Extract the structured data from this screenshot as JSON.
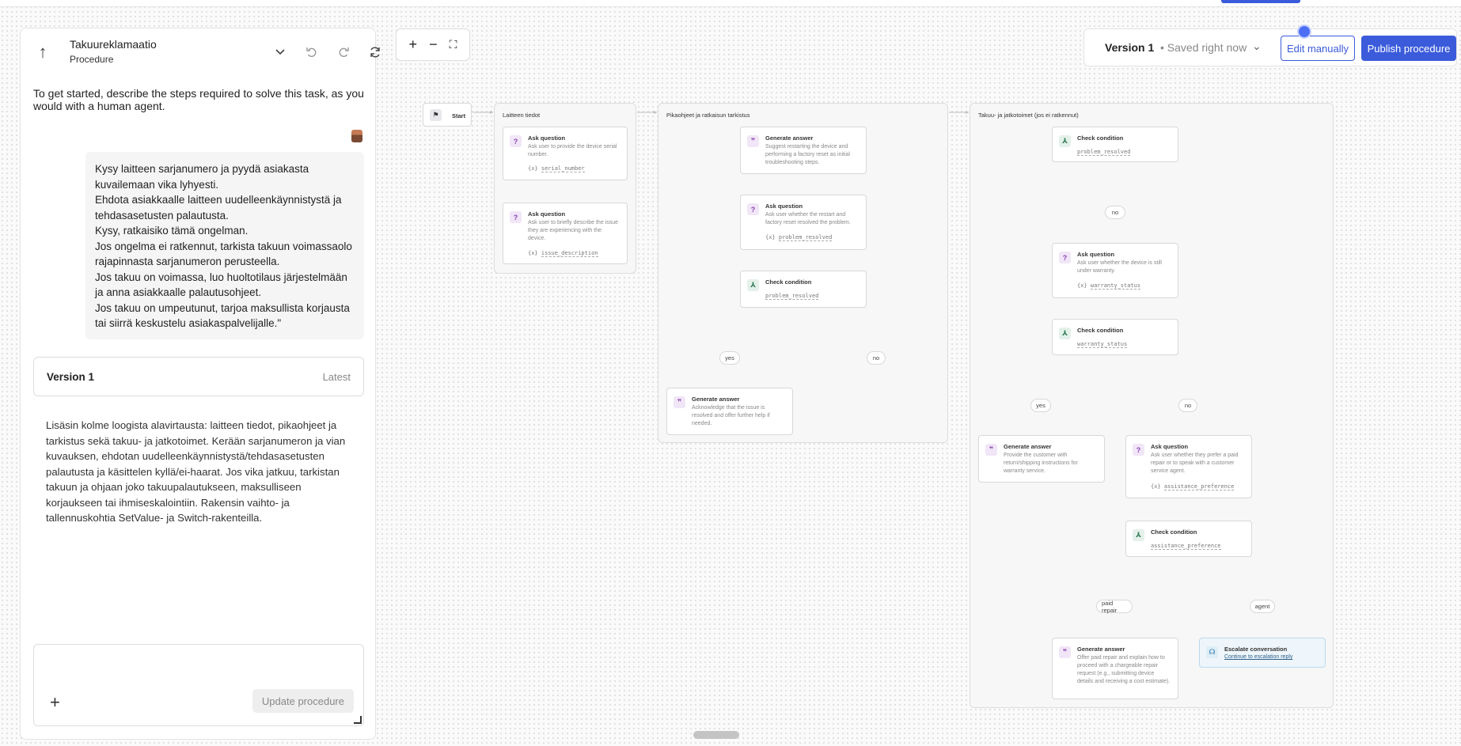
{
  "procedure": {
    "title": "Takuureklamaatio",
    "subtitle": "Procedure"
  },
  "chat": {
    "intro": "To get started, describe the steps required to solve this task, as you would with a human agent.",
    "user_lines": [
      "Kysy laitteen sarjanumero ja pyydä asiakasta kuvailemaan vika lyhyesti.",
      "Ehdota asiakkaalle laitteen uudelleenkäynnistystä ja tehdasasetusten palautusta.",
      "Kysy, ratkaisiko tämä ongelman.",
      "Jos ongelma ei ratkennut, tarkista takuun voimassaolo rajapinnasta sarjanumeron perusteella.",
      "Jos takuu on voimassa, luo huoltotilaus järjestelmään ja anna asiakkaalle palautusohjeet.",
      "Jos takuu on umpeutunut, tarjoa maksullista korjausta tai siirrä keskustelu asiakaspalvelijalle.\""
    ],
    "version_title": "Version 1",
    "version_label": "Latest",
    "assistant_reply": "Lisäsin kolme loogista alavirtausta: laitteen tiedot, pikaohjeet ja tarkistus sekä takuu- ja jatkotoimet. Kerään sarjanumeron ja vian kuvauksen, ehdotan uudelleenkäynnistystä/tehdasasetusten palautusta ja käsittelen kyllä/ei-haarat. Jos vika jatkuu, tarkistan takuun ja ohjaan joko takuupalautukseen, maksulliseen korjaukseen tai ihmiseskalointiin. Rakensin vaihto- ja tallennuskohtia SetValue- ja Switch-rakenteilla.",
    "composer_placeholder": "",
    "update_button": "Update procedure"
  },
  "zoom": {
    "in": "+",
    "out": "−",
    "fit": "⛶"
  },
  "versionbar": {
    "version": "Version 1",
    "status": "• Saved right now",
    "edit_button": "Edit manually",
    "publish_button": "Publish procedure"
  },
  "flow": {
    "start_label": "Start",
    "groups": [
      {
        "label": "Laitteen tiedot"
      },
      {
        "label": "Pikaohjeet ja ratkaisun tarkistus"
      },
      {
        "label": "Takuu- ja jatkotoimet (jos ei ratkennut)"
      }
    ],
    "nodes": {
      "ask_serial": {
        "title": "Ask question",
        "desc": "Ask user to provide the device serial number.",
        "var": "serial_number"
      },
      "ask_issue": {
        "title": "Ask question",
        "desc": "Ask user to briefly describe the issue they are experiencing with the device.",
        "var": "issue_description"
      },
      "gen_restart": {
        "title": "Generate answer",
        "desc": "Suggest restarting the device and performing a factory reset as initial troubleshooting steps."
      },
      "ask_resolved": {
        "title": "Ask question",
        "desc": "Ask user whether the restart and factory reset resolved the problem.",
        "var": "problem_resolved"
      },
      "check_resolved": {
        "title": "Check condition",
        "var": "problem_resolved"
      },
      "gen_ack": {
        "title": "Generate answer",
        "desc": "Acknowledge that the issue is resolved and offer further help if needed."
      },
      "check_resolved2": {
        "title": "Check condition",
        "var": "problem_resolved"
      },
      "ask_warranty": {
        "title": "Ask question",
        "desc": "Ask user whether the device is still under warranty.",
        "var": "warranty_status"
      },
      "check_warranty": {
        "title": "Check condition",
        "var": "warranty_status"
      },
      "gen_return": {
        "title": "Generate answer",
        "desc": "Provide the customer with return/shipping instructions for warranty service."
      },
      "ask_pref": {
        "title": "Ask question",
        "desc": "Ask user whether they prefer a paid repair or to speak with a customer service agent.",
        "var": "assistance_preference"
      },
      "check_pref": {
        "title": "Check condition",
        "var": "assistance_preference"
      },
      "gen_paid": {
        "title": "Generate answer",
        "desc": "Offer paid repair and explain how to proceed with a chargeable repair request (e.g., submitting device details and receiving a cost estimate)."
      },
      "escalate": {
        "title": "Escalate conversation",
        "link": "Continue to escalation reply"
      }
    },
    "branches": {
      "yes1": "yes",
      "no1": "no",
      "no2": "no",
      "yes3": "yes",
      "no3": "no",
      "paid": "paid repair",
      "agent": "agent"
    }
  }
}
